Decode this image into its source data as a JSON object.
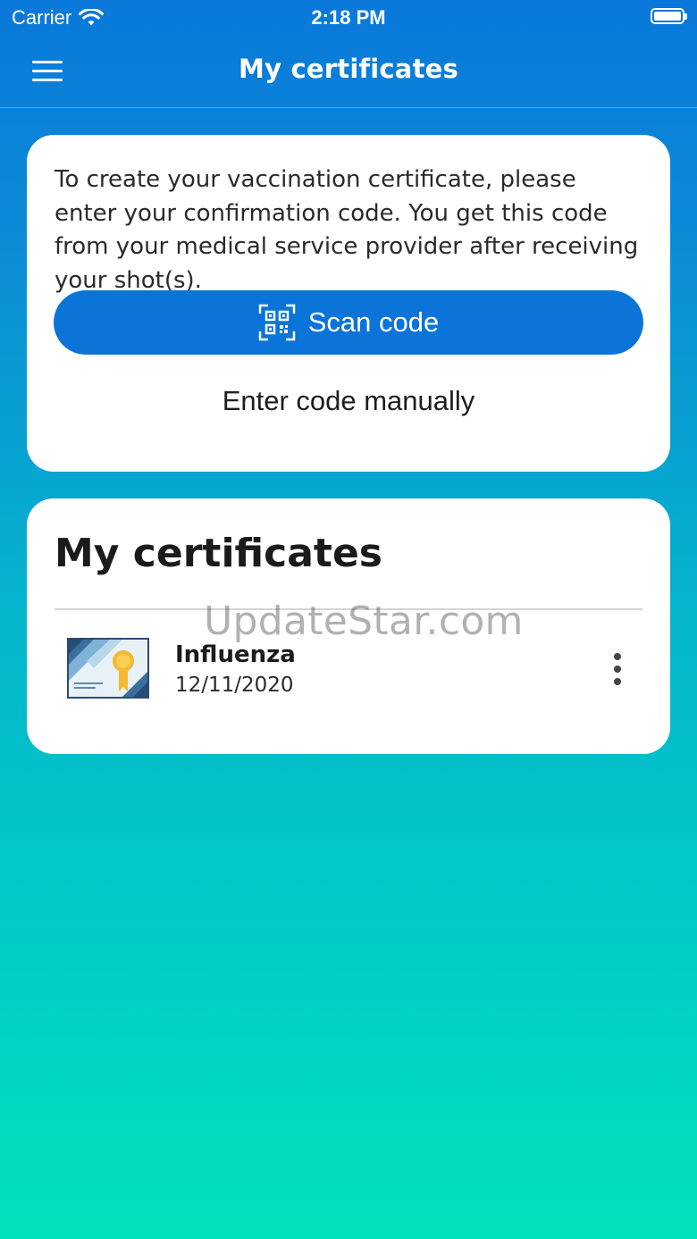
{
  "status_bar": {
    "carrier": "Carrier",
    "time": "2:18 PM",
    "wifi_icon": "wifi-icon",
    "battery_icon": "battery-icon"
  },
  "nav": {
    "title": "My certificates",
    "menu_icon": "hamburger-menu-icon"
  },
  "create_card": {
    "instructions": "To create your vaccination certificate, please enter your confirmation code. You get this code from your medical service provider after receiving your shot(s).",
    "scan_button_label": "Scan code",
    "scan_icon": "qr-code-icon",
    "manual_button_label": "Enter code manually"
  },
  "certificates": {
    "heading": "My certificates",
    "items": [
      {
        "name": "Influenza",
        "date": "12/11/2020",
        "icon": "certificate-icon",
        "menu_icon": "more-vertical-icon"
      }
    ]
  },
  "watermark": "UpdateStar.com",
  "colors": {
    "primary": "#0a74d8",
    "gradient_top": "#0a78da",
    "gradient_bottom": "#00e2bb",
    "card_bg": "#ffffff"
  }
}
